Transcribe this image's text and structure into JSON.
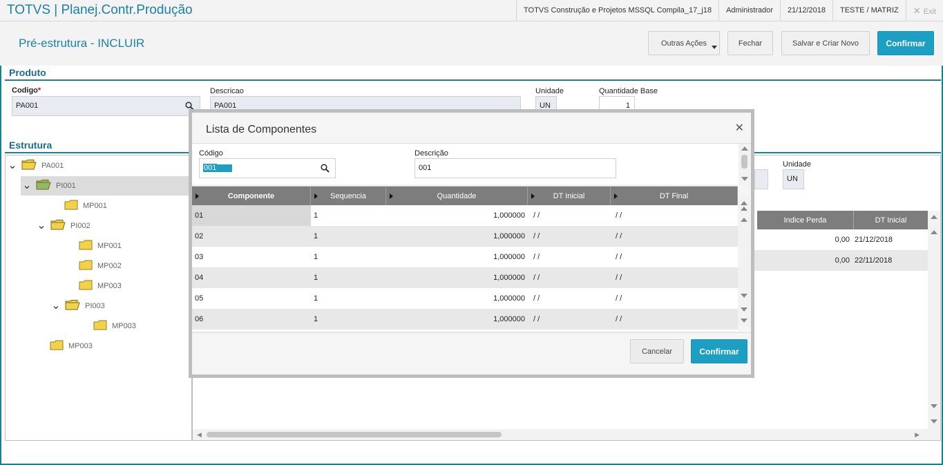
{
  "app": {
    "title": "TOTVS | Planej.Contr.Produção",
    "environment": "TOTVS Construção e Projetos MSSQL Compila_17_j18",
    "user": "Administrador",
    "date": "21/12/2018",
    "branch": "TESTE / MATRIZ",
    "exit_label": "Exit"
  },
  "header": {
    "page_title": "Pré-estrutura - INCLUIR",
    "actions": {
      "more": "Outras Ações",
      "close": "Fechar",
      "save_new": "Salvar e Criar Novo",
      "confirm": "Confirmar"
    }
  },
  "produto": {
    "section_title": "Produto",
    "codigo_label": "Codigo",
    "codigo_value": "PA001",
    "descricao_label": "Descricao",
    "descricao_value": "PA001",
    "unidade_label": "Unidade",
    "unidade_value": "UN",
    "qtd_base_label": "Quantidade Base",
    "qtd_base_value": "1"
  },
  "estrutura": {
    "section_title": "Estrutura",
    "tree": [
      {
        "label": "PA001",
        "level": 0,
        "expanded": true,
        "open": true
      },
      {
        "label": "PI001",
        "level": 1,
        "expanded": true,
        "open": true,
        "selected": true
      },
      {
        "label": "MP001",
        "level": 2,
        "expanded": false
      },
      {
        "label": "PI002",
        "level": 2,
        "expanded": true,
        "open": true
      },
      {
        "label": "MP001",
        "level": 3,
        "expanded": false
      },
      {
        "label": "MP002",
        "level": 3,
        "expanded": false
      },
      {
        "label": "MP003",
        "level": 3,
        "expanded": false
      },
      {
        "label": "PI003",
        "level": 3,
        "expanded": true,
        "open": true
      },
      {
        "label": "MP003",
        "level": 4,
        "expanded": false
      },
      {
        "label": "MP003",
        "level": 1,
        "expanded": false
      }
    ],
    "right_unidade_label": "Unidade",
    "right_unidade_value": "UN",
    "grid_headers": [
      "Indice Perda",
      "DT Inicial"
    ],
    "grid_rows": [
      {
        "indice_perda": "0,00",
        "dt_inicial": "21/12/2018"
      },
      {
        "indice_perda": "0,00",
        "dt_inicial": "22/11/2018"
      }
    ]
  },
  "modal": {
    "title": "Lista de Componentes",
    "codigo_label": "Código",
    "codigo_value": "001",
    "descricao_label": "Descrição",
    "descricao_value": "001",
    "columns": [
      "Componente",
      "Sequencia",
      "Quantidade",
      "DT Inicial",
      "DT Final"
    ],
    "rows": [
      {
        "componente": "01",
        "sequencia": "1",
        "quantidade": "1,000000",
        "dt_inicial": "/ /",
        "dt_final": "/ /"
      },
      {
        "componente": "02",
        "sequencia": "1",
        "quantidade": "1,000000",
        "dt_inicial": "/ /",
        "dt_final": "/ /"
      },
      {
        "componente": "03",
        "sequencia": "1",
        "quantidade": "1,000000",
        "dt_inicial": "/ /",
        "dt_final": "/ /"
      },
      {
        "componente": "04",
        "sequencia": "1",
        "quantidade": "1,000000",
        "dt_inicial": "/ /",
        "dt_final": "/ /"
      },
      {
        "componente": "05",
        "sequencia": "1",
        "quantidade": "1,000000",
        "dt_inicial": "/ /",
        "dt_final": "/ /"
      },
      {
        "componente": "06",
        "sequencia": "1",
        "quantidade": "1,000000",
        "dt_inicial": "/ /",
        "dt_final": "/ /"
      }
    ],
    "cancel_label": "Cancelar",
    "confirm_label": "Confirmar"
  },
  "colors": {
    "accent": "#1d9fc4",
    "title_blue": "#1d7fa6",
    "frame_teal": "#1c7f8c",
    "grid_header": "#7d7d7d"
  }
}
